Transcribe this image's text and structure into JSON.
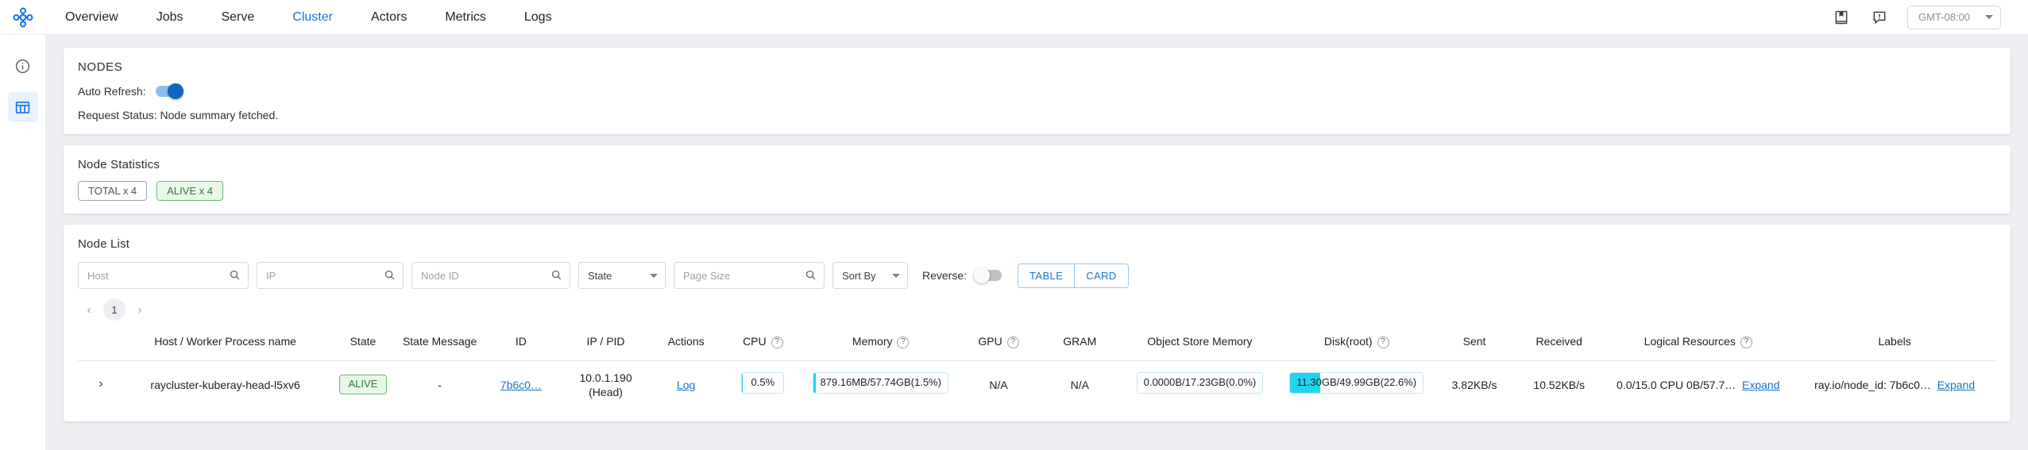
{
  "nav": {
    "logo_icon": "ray-logo-icon",
    "links": [
      {
        "label": "Overview",
        "active": false
      },
      {
        "label": "Jobs",
        "active": false
      },
      {
        "label": "Serve",
        "active": false
      },
      {
        "label": "Cluster",
        "active": true
      },
      {
        "label": "Actors",
        "active": false
      },
      {
        "label": "Metrics",
        "active": false
      },
      {
        "label": "Logs",
        "active": false
      }
    ],
    "right": {
      "docs_icon": "book-icon",
      "feedback_icon": "feedback-icon",
      "timezone": "GMT-08:00"
    }
  },
  "rail": {
    "items": [
      {
        "icon": "info-circle-icon",
        "active": false
      },
      {
        "icon": "table-grid-icon",
        "active": true
      }
    ]
  },
  "nodes_card": {
    "title": "NODES",
    "auto_refresh_label": "Auto Refresh:",
    "auto_refresh_on": true,
    "request_status": "Request Status: Node summary fetched."
  },
  "node_statistics": {
    "title": "Node Statistics",
    "chips": [
      {
        "label": "TOTAL x 4",
        "kind": "total"
      },
      {
        "label": "ALIVE x 4",
        "kind": "alive"
      }
    ]
  },
  "node_list": {
    "title": "Node List",
    "filters": {
      "host_placeholder": "Host",
      "ip_placeholder": "IP",
      "node_id_placeholder": "Node ID",
      "state_label": "State",
      "page_size_placeholder": "Page Size",
      "sort_by_label": "Sort By",
      "reverse_label": "Reverse:",
      "reverse_on": false,
      "view_table": "TABLE",
      "view_card": "CARD"
    },
    "pagination": {
      "prev": "‹",
      "page": "1",
      "next": "›"
    },
    "columns": [
      {
        "label": "",
        "help": false
      },
      {
        "label": "Host / Worker Process name",
        "help": false
      },
      {
        "label": "State",
        "help": false
      },
      {
        "label": "State Message",
        "help": false
      },
      {
        "label": "ID",
        "help": false
      },
      {
        "label": "IP / PID",
        "help": false
      },
      {
        "label": "Actions",
        "help": false
      },
      {
        "label": "CPU",
        "help": true
      },
      {
        "label": "Memory",
        "help": true
      },
      {
        "label": "GPU",
        "help": true
      },
      {
        "label": "GRAM",
        "help": false
      },
      {
        "label": "Object Store Memory",
        "help": false
      },
      {
        "label": "Disk(root)",
        "help": true
      },
      {
        "label": "Sent",
        "help": false
      },
      {
        "label": "Received",
        "help": false
      },
      {
        "label": "Logical Resources",
        "help": true
      },
      {
        "label": "Labels",
        "help": false
      }
    ],
    "rows": [
      {
        "expander": "›",
        "host": "raycluster-kuberay-head-l5xv6",
        "state": "ALIVE",
        "state_message": "-",
        "id": "7b6c0…",
        "ip": "10.0.1.190",
        "ip_role": "(Head)",
        "actions": "Log",
        "cpu_text": "0.5%",
        "cpu_pct": 0.5,
        "memory_text": "879.16MB/57.74GB(1.5%)",
        "memory_pct": 1.5,
        "gpu": "N/A",
        "gram": "N/A",
        "object_store_text": "0.0000B/17.23GB(0.0%)",
        "object_store_pct": 0.0,
        "disk_text": "11.30GB/49.99GB(22.6%)",
        "disk_pct": 22.6,
        "sent": "3.82KB/s",
        "received": "10.52KB/s",
        "logical_resources": "0.0/15.0 CPU 0B/57.7…",
        "logical_resources_expand": "Expand",
        "labels": "ray.io/node_id: 7b6c0…",
        "labels_expand": "Expand"
      }
    ]
  }
}
